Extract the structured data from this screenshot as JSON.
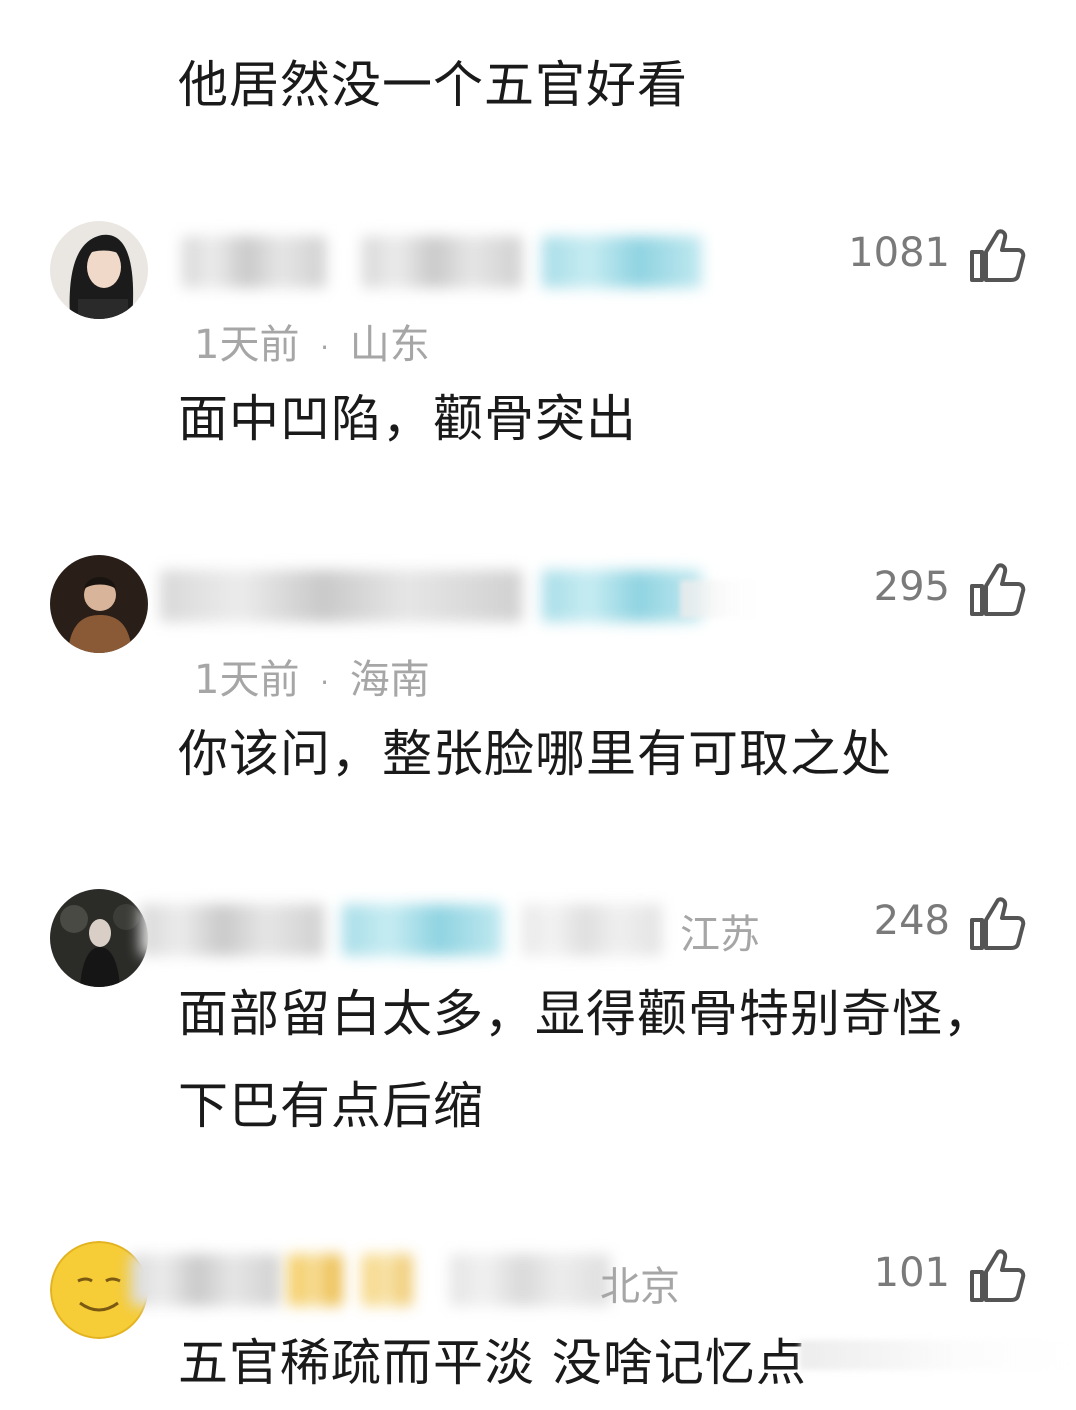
{
  "top_comment": {
    "text": "他居然没一个五官好看"
  },
  "comments": [
    {
      "likes": "1081",
      "meta_time": "1天前",
      "meta_sep": "·",
      "meta_location": "山东",
      "text_lines": [
        "面中凹陷，颧骨突出"
      ],
      "avatar_icon": "avatar-photo-girl"
    },
    {
      "likes": "295",
      "meta_time": "1天前",
      "meta_sep": "·",
      "meta_location": "海南",
      "text_lines": [
        "你该问，整张脸哪里有可取之处"
      ],
      "avatar_icon": "avatar-photo-man"
    },
    {
      "likes": "248",
      "meta_location": "江苏",
      "text_lines": [
        "面部留白太多，显得颧骨特别奇怪，",
        "下巴有点后缩"
      ],
      "avatar_icon": "avatar-photo-night"
    },
    {
      "likes": "101",
      "meta_location": "北京",
      "text_lines": [
        "五官稀疏而平淡 没啥记忆点"
      ],
      "avatar_icon": "avatar-emoji-smile"
    }
  ],
  "icons": {
    "like": "thumbs-up-icon"
  },
  "colors": {
    "text": "#1a1a1a",
    "meta": "#a6a6a6",
    "likes": "#7a7a7a",
    "background": "#ffffff"
  }
}
